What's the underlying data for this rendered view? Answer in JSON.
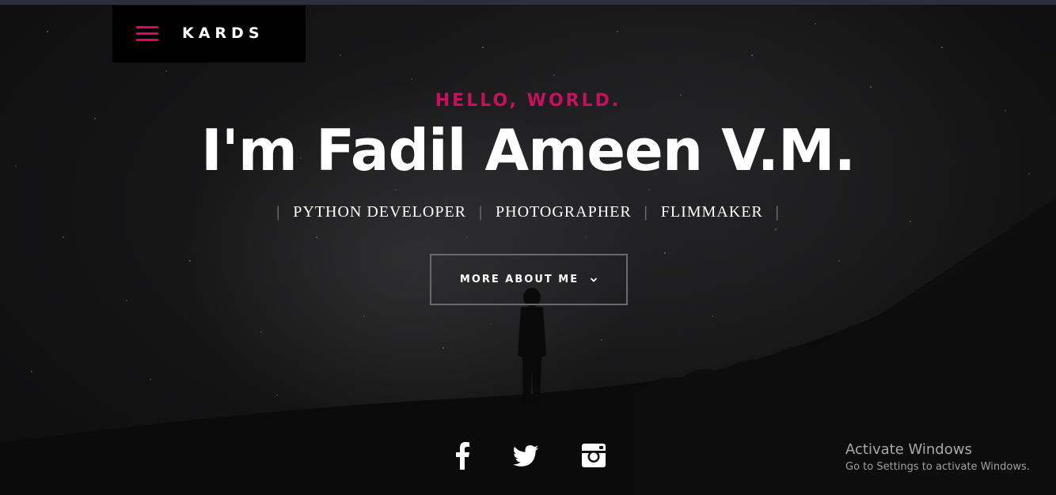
{
  "brand": {
    "menu_icon": "hamburger-icon",
    "name": "KARDS"
  },
  "hero": {
    "greeting": "HELLO, WORLD.",
    "name": "I'm Fadil Ameen V.M.",
    "roles": [
      "PYTHON DEVELOPER",
      "PHOTOGRAPHER",
      "FLIMMAKER"
    ],
    "separator": "|"
  },
  "cta": {
    "label": "MORE ABOUT ME",
    "icon": "chevron-down-icon"
  },
  "social": [
    {
      "name": "facebook",
      "icon": "facebook-icon"
    },
    {
      "name": "twitter",
      "icon": "twitter-icon"
    },
    {
      "name": "instagram",
      "icon": "instagram-icon"
    }
  ],
  "watermark": {
    "title": "Activate Windows",
    "subtitle": "Go to Settings to activate Windows."
  },
  "colors": {
    "accent": "#e6005f",
    "greeting": "#c7105e",
    "background": "#141415",
    "text": "#ffffff"
  }
}
